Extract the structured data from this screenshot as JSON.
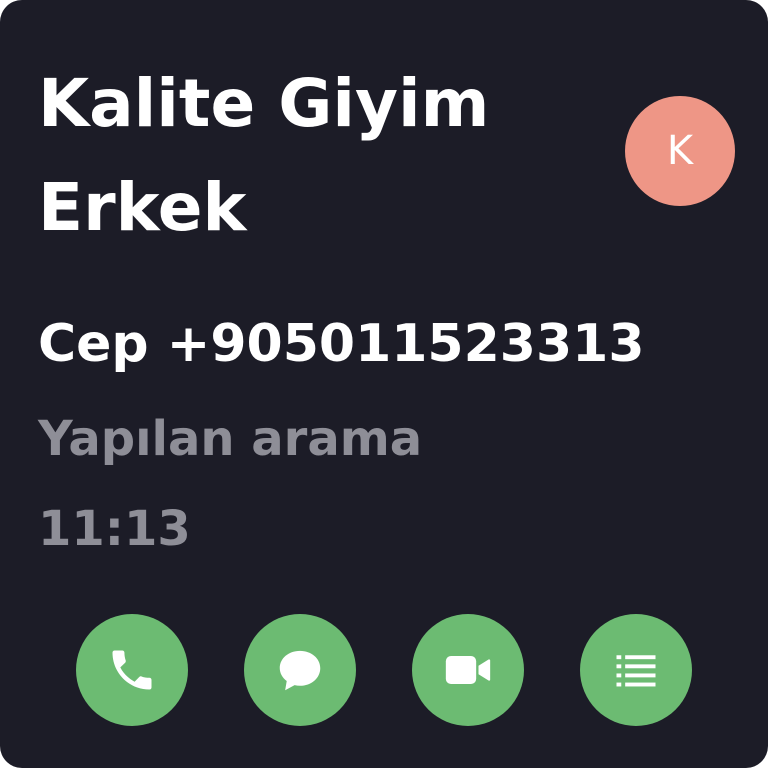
{
  "contact": {
    "name_line1": "Kalite Giyim",
    "name_line2": "Erkek",
    "avatar_initial": "K",
    "phone_label": "Cep",
    "phone_number": "+905011523313",
    "call_type": "Yapılan arama",
    "call_time": "11:13"
  },
  "actions": [
    {
      "icon": "phone-icon"
    },
    {
      "icon": "message-icon"
    },
    {
      "icon": "video-camera-icon"
    },
    {
      "icon": "details-list-icon"
    }
  ],
  "colors": {
    "background": "#1c1c27",
    "avatar": "#ee9686",
    "action_button": "#6cbb72",
    "primary_text": "#ffffff",
    "secondary_text": "#8e8e97"
  }
}
